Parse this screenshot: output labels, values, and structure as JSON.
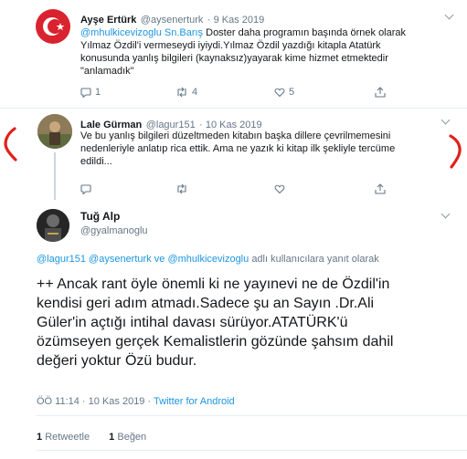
{
  "tweet1": {
    "name": "Ayşe Ertürk",
    "handle": "@aysenerturk",
    "time": "· 9 Kas 2019",
    "mention": "@mhulkicevizoglu",
    "mention2": "Sn.Barış",
    "text_line1": "Doster daha programın başında örnek olarak",
    "text_line2": "Yılmaz Özdil'i vermeseydi iyiydi.Yılmaz Özdil yazdığı kitapla Atatürk",
    "text_line3": "konusunda yanlış bilgileri (kaynaksız)yayarak kime hizmet etmektedir",
    "text_line4": "\"anlamadık\"",
    "reply_count": "1",
    "retweet_count": "4",
    "like_count": "5"
  },
  "tweet2": {
    "name": "Lale Gürman",
    "handle": "@lagur151",
    "time": "· 10 Kas 2019",
    "text_line1": "Ve bu yanlış bilgileri düzeltmeden kitabın başka dillere çevrilmemesini",
    "text_line2": "nedenleriyle anlatıp rica ettik. Ama ne yazık ki kitap ilk şekliyle tercüme",
    "text_line3": "edildi..."
  },
  "tweet3": {
    "name": "Tuğ Alp",
    "handle": "@gyalmanoglu",
    "reply_to_1": "@lagur151",
    "reply_to_2": "@aysenerturk",
    "reply_ve": "ve",
    "reply_to_3": "@mhulkicevizoglu",
    "reply_suffix": "adlı kullanıcılara yanıt olarak",
    "text_line1": "++ Ancak  rant öyle önemli ki ne yayınevi ne de Özdil'in",
    "text_line2": "kendisi geri adım atmadı.Sadece şu an Sayın .Dr.Ali",
    "text_line3": "Güler'in açtığı intihal davası sürüyor.ATATÜRK'ü",
    "text_line4": "özümseyen gerçek Kemalistlerin gözünde şahsım dahil",
    "text_line5": "değeri yoktur Özü budur.",
    "timestamp": "ÖÖ 11:14 · 10 Kas 2019 ·",
    "source": "Twitter for Android",
    "retweets_count": "1",
    "retweets_label": "Retweetle",
    "likes_count": "1",
    "likes_label": "Beğen"
  },
  "colors": {
    "link": "#1b95e0",
    "secondary": "#657786",
    "annotation": "#e0201b"
  }
}
